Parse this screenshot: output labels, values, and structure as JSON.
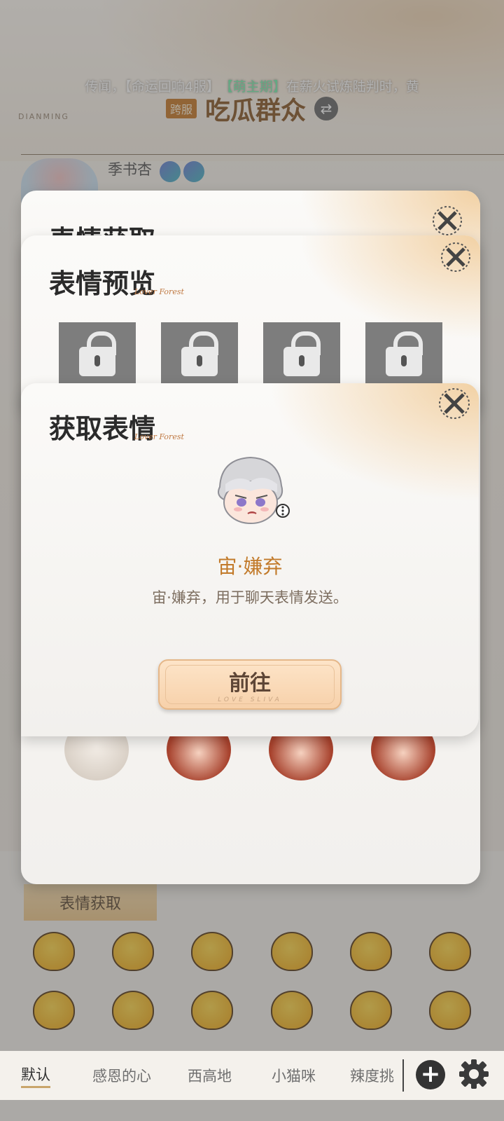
{
  "chat": {
    "marquee_prefix": "传闻，【命运回响4服】",
    "marquee_highlight": "【萌主期】",
    "marquee_suffix": "在薪火试炼陆判时，黄",
    "cross_server_badge": "跨服",
    "title": "吃瓜群众",
    "brand_text": "DIANMING",
    "message_sender": "季书杏"
  },
  "panels": {
    "back_title": "表情获取",
    "preview_title": "表情预览",
    "preview_script": "Lover Forest",
    "dialog_title": "获取表情",
    "dialog_script": "Lover Forest"
  },
  "dialog": {
    "item_name": "宙·嫌弃",
    "item_desc": "宙·嫌弃，用于聊天表情发送。",
    "go_label": "前往",
    "go_sub": "LOVE SLIVA"
  },
  "emoji_panel": {
    "get_tab_label": "表情获取",
    "tabs": [
      "默认",
      "感恩的心",
      "西高地",
      "小猫咪",
      "辣度挑"
    ]
  },
  "colors": {
    "accent_orange": "#c27a2a",
    "marquee_highlight": "#7bf0b0",
    "button_fill": "#f7d1aa"
  },
  "icons": {
    "close": "close-x-icon",
    "swap": "swap-arrows-icon",
    "lock": "lock-icon",
    "add": "plus-circle-icon",
    "settings": "gear-icon"
  }
}
